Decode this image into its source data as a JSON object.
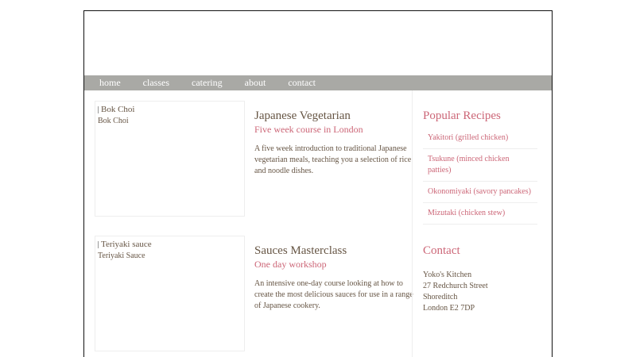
{
  "nav": {
    "items": [
      "home",
      "classes",
      "catering",
      "about",
      "contact"
    ]
  },
  "articles": [
    {
      "image_alt": "Bok Choi",
      "caption": "Bok Choi",
      "title": "Japanese Vegetarian",
      "subtitle": "Five week course in London",
      "text": "A five week introduction to traditional Japanese vegetarian meals, teaching you a selection of rice and noodle dishes."
    },
    {
      "image_alt": "Teriyaki sauce",
      "caption": "Teriyaki Sauce",
      "title": "Sauces Masterclass",
      "subtitle": "One day workshop",
      "text": "An intensive one-day course looking at how to create the most delicious sauces for use in a range of Japanese cookery."
    }
  ],
  "sidebar": {
    "popular_heading": "Popular Recipes",
    "recipes": [
      "Yakitori (grilled chicken)",
      "Tsukune (minced chicken patties)",
      "Okonomiyaki (savory pancakes)",
      "Mizutaki (chicken stew)"
    ],
    "contact_heading": "Contact",
    "address": [
      "Yoko's Kitchen",
      "27 Redchurch Street",
      "Shoreditch",
      "London E2 7DP"
    ]
  },
  "colors": {
    "nav_bg": "#a9a9a5",
    "accent": "#cc6677",
    "text": "#665544",
    "border": "#eeeeee"
  }
}
